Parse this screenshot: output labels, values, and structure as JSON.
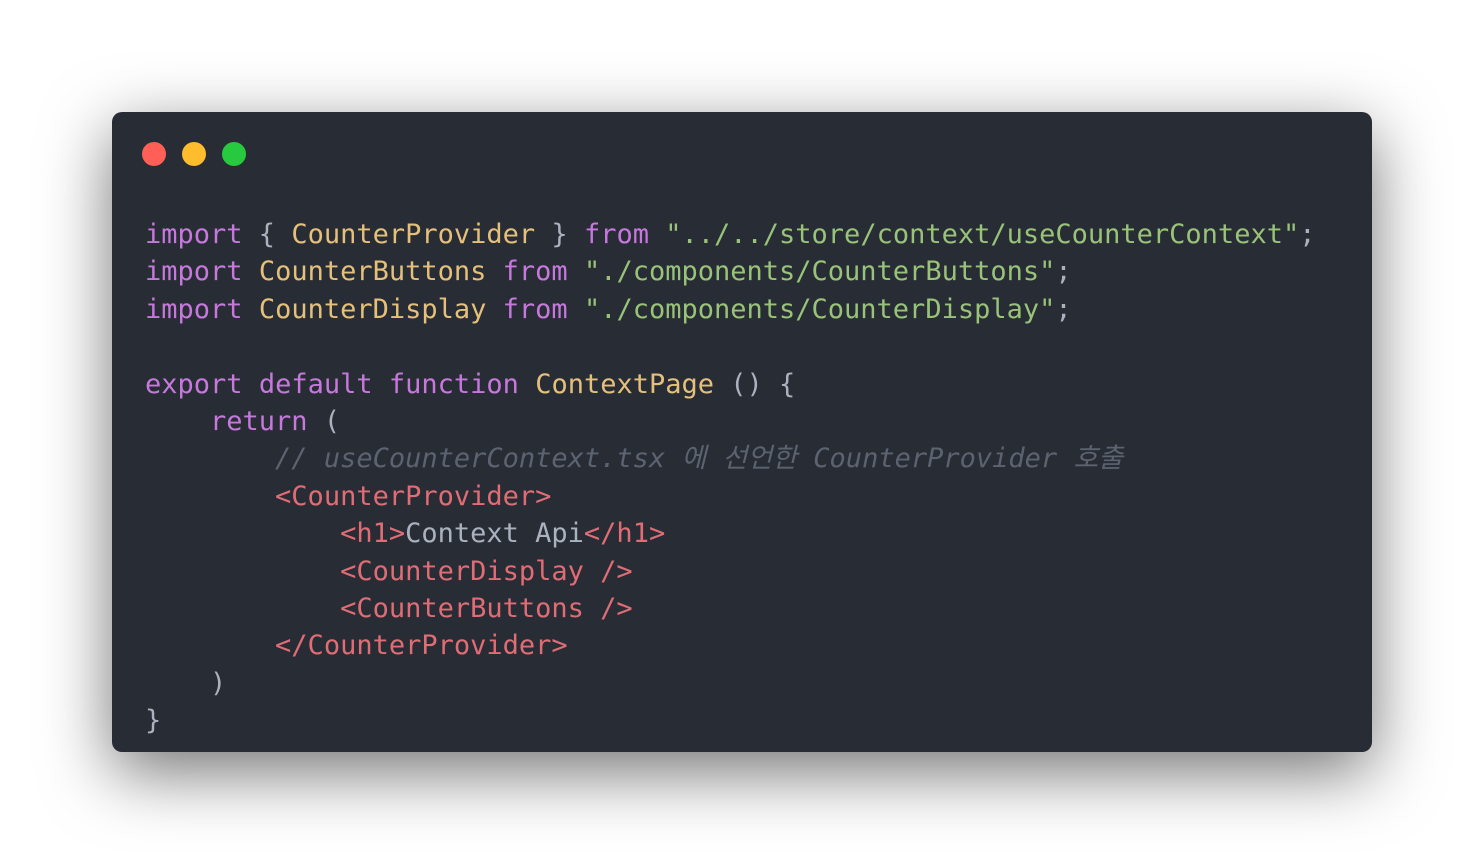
{
  "window": {
    "controls": [
      {
        "name": "close",
        "color": "#ff5f56"
      },
      {
        "name": "minimize",
        "color": "#ffbd2e"
      },
      {
        "name": "maximize",
        "color": "#27c93f"
      }
    ]
  },
  "code": {
    "lines": [
      [
        {
          "t": "import",
          "k": "kw"
        },
        {
          "t": " { ",
          "k": "pun"
        },
        {
          "t": "CounterProvider",
          "k": "id"
        },
        {
          "t": " } ",
          "k": "pun"
        },
        {
          "t": "from",
          "k": "kw"
        },
        {
          "t": " ",
          "k": "pun"
        },
        {
          "t": "\"../../store/context/useCounterContext\"",
          "k": "str"
        },
        {
          "t": ";",
          "k": "pun"
        }
      ],
      [
        {
          "t": "import",
          "k": "kw"
        },
        {
          "t": " ",
          "k": "pun"
        },
        {
          "t": "CounterButtons",
          "k": "id"
        },
        {
          "t": " ",
          "k": "pun"
        },
        {
          "t": "from",
          "k": "kw"
        },
        {
          "t": " ",
          "k": "pun"
        },
        {
          "t": "\"./components/CounterButtons\"",
          "k": "str"
        },
        {
          "t": ";",
          "k": "pun"
        }
      ],
      [
        {
          "t": "import",
          "k": "kw"
        },
        {
          "t": " ",
          "k": "pun"
        },
        {
          "t": "CounterDisplay",
          "k": "id"
        },
        {
          "t": " ",
          "k": "pun"
        },
        {
          "t": "from",
          "k": "kw"
        },
        {
          "t": " ",
          "k": "pun"
        },
        {
          "t": "\"./components/CounterDisplay\"",
          "k": "str"
        },
        {
          "t": ";",
          "k": "pun"
        }
      ],
      [],
      [
        {
          "t": "export",
          "k": "kw"
        },
        {
          "t": " ",
          "k": "pun"
        },
        {
          "t": "default",
          "k": "kw"
        },
        {
          "t": " ",
          "k": "pun"
        },
        {
          "t": "function",
          "k": "kw"
        },
        {
          "t": " ",
          "k": "pun"
        },
        {
          "t": "ContextPage",
          "k": "id"
        },
        {
          "t": " () {",
          "k": "pun"
        }
      ],
      [
        {
          "t": "    ",
          "k": "pun"
        },
        {
          "t": "return",
          "k": "kw"
        },
        {
          "t": " (",
          "k": "pun"
        }
      ],
      [
        {
          "t": "        ",
          "k": "pun"
        },
        {
          "t": "// useCounterContext.tsx 에 선언한 CounterProvider 호출",
          "k": "cmt"
        }
      ],
      [
        {
          "t": "        ",
          "k": "pun"
        },
        {
          "t": "<CounterProvider>",
          "k": "tag"
        }
      ],
      [
        {
          "t": "            ",
          "k": "pun"
        },
        {
          "t": "<h1>",
          "k": "tag"
        },
        {
          "t": "Context Api",
          "k": "txt"
        },
        {
          "t": "</h1>",
          "k": "tag"
        }
      ],
      [
        {
          "t": "            ",
          "k": "pun"
        },
        {
          "t": "<CounterDisplay />",
          "k": "tag"
        }
      ],
      [
        {
          "t": "            ",
          "k": "pun"
        },
        {
          "t": "<CounterButtons />",
          "k": "tag"
        }
      ],
      [
        {
          "t": "        ",
          "k": "pun"
        },
        {
          "t": "</CounterProvider>",
          "k": "tag"
        }
      ],
      [
        {
          "t": "    )",
          "k": "pun"
        }
      ],
      [
        {
          "t": "}",
          "k": "pun"
        }
      ]
    ]
  }
}
